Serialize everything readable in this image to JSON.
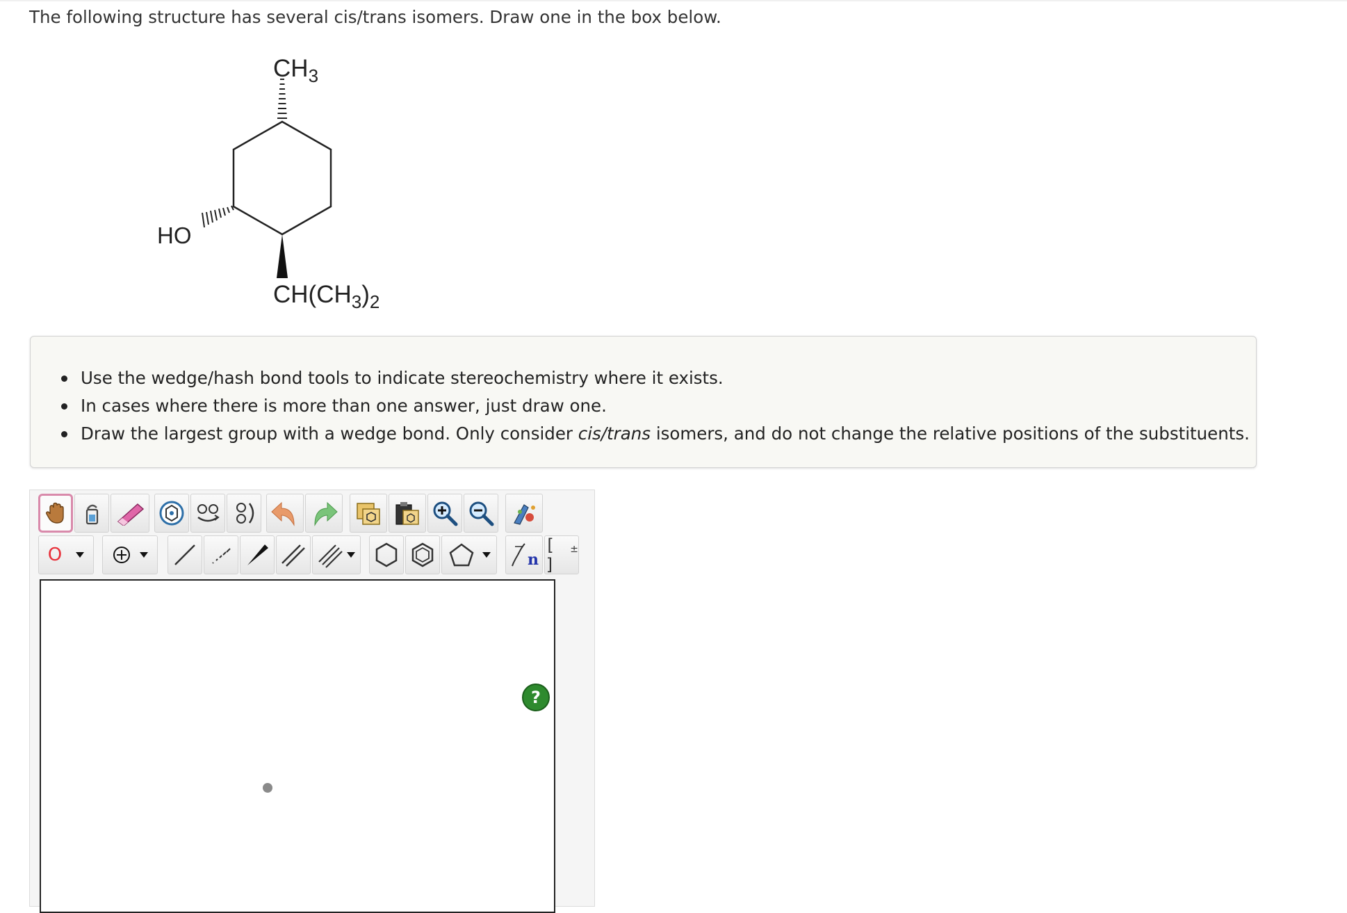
{
  "question": {
    "text": "The following structure has several cis/trans isomers. Draw one in the box below."
  },
  "molecule": {
    "substituent_top": {
      "main": "CH",
      "sub": "3"
    },
    "substituent_left": "HO",
    "substituent_bottom": {
      "main": "CH(CH",
      "sub1": "3",
      "close": ")",
      "sub2": "2"
    }
  },
  "instructions": {
    "items": [
      "Use the wedge/hash bond tools to indicate stereochemistry where it exists.",
      "In cases where there is more than one answer, just draw one."
    ],
    "item3": {
      "before": "Draw the largest group with a wedge bond. Only consider ",
      "em": "cis/trans",
      "after": " isomers, and do not change the relative positions of the substituents."
    }
  },
  "toolbar": {
    "atom_label": "O",
    "polymer_label": "n",
    "bracket_label": "[ ]",
    "bracket_charge": "±"
  },
  "editor": {
    "help_label": "?"
  },
  "colors": {
    "selected_border": "#d98aab",
    "help_green": "#2e8a2e",
    "atom_red": "#e8303a",
    "undo_orange": "#e89a6a",
    "redo_green": "#7ac47a"
  },
  "icons": [
    "hand-icon",
    "lasso-icon",
    "eraser-icon",
    "template-icon",
    "rotate-horizontal-icon",
    "rotate-vertical-icon",
    "undo-icon",
    "redo-icon",
    "copy-icon",
    "paste-icon",
    "zoom-in-icon",
    "zoom-out-icon",
    "clean-structure-icon",
    "charge-icon",
    "single-bond-icon",
    "hash-bond-icon",
    "wedge-bond-icon",
    "double-bond-icon",
    "triple-bond-icon",
    "cyclohexane-icon",
    "benzene-icon",
    "cyclopentane-icon",
    "polymer-bracket-icon",
    "bracket-charge-icon",
    "help-icon"
  ]
}
